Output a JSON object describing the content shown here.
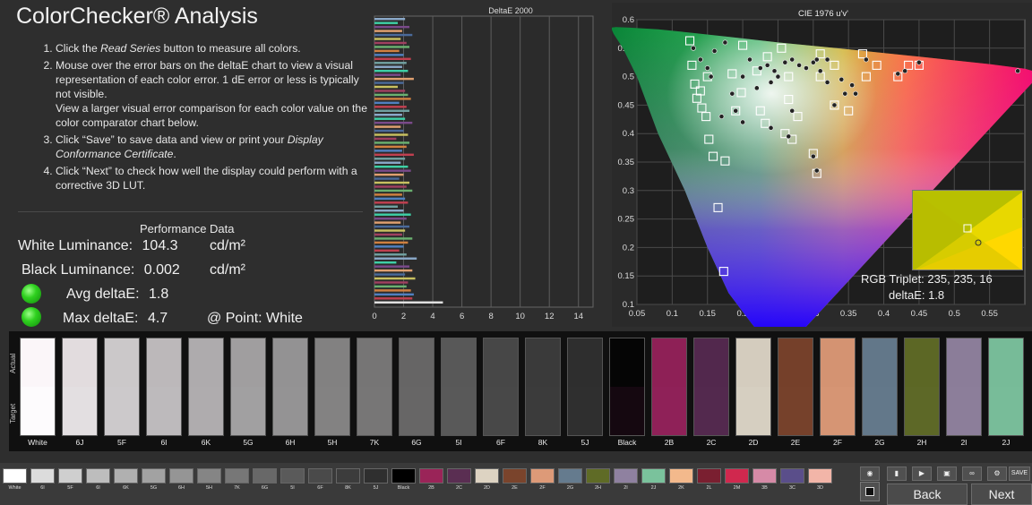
{
  "title": "ColorChecker® Analysis",
  "steps": [
    {
      "pre": "Click the ",
      "em": "Read Series",
      "post": " button to measure all colors."
    },
    {
      "pre": "Mouse over the error bars on the deltaE chart to view a visual representation of each color error. 1 dE error or less is typically not visible.",
      "em": "",
      "post": ""
    },
    {
      "pre": "Click “Save” to save data and view or print your ",
      "em": "Display Conformance Certificate",
      "post": "."
    },
    {
      "pre": "Click “Next” to check how well the display could perform with a corrective 3D LUT.",
      "em": "",
      "post": ""
    }
  ],
  "step2_extra": "View a larger visual error comparison for each color value on the color comparator chart below.",
  "performance": {
    "heading": "Performance Data",
    "white_label": "White Luminance:",
    "white_value": "104.3",
    "white_unit": "cd/m²",
    "black_label": "Black Luminance:",
    "black_value": "0.002",
    "black_unit": "cd/m²",
    "avg_label": "Avg deltaE:",
    "avg_value": "1.8",
    "max_label": "Max deltaE:",
    "max_value": "4.7",
    "point_label": "@ Point: White",
    "status_color": "#2fd11f"
  },
  "chart_data": [
    {
      "type": "bar",
      "title": "DeltaE 2000",
      "orientation": "horizontal",
      "xlim": [
        0,
        15
      ],
      "xticks": [
        0,
        2,
        4,
        6,
        8,
        10,
        12,
        14
      ],
      "grid": true,
      "values": [
        2.1,
        1.6,
        2.4,
        1.9,
        2.6,
        1.8,
        2.2,
        2.4,
        1.7,
        2.0,
        2.5,
        2.2,
        1.9,
        2.3,
        1.8,
        2.7,
        2.0,
        1.6,
        2.1,
        2.3,
        2.5,
        1.7,
        2.2,
        2.4,
        1.9,
        2.1,
        2.6,
        1.8,
        2.0,
        2.3,
        1.5,
        2.4,
        2.2,
        1.9,
        2.7,
        2.1,
        1.8,
        2.3,
        2.5,
        2.0,
        1.7,
        2.4,
        2.2,
        2.6,
        1.9,
        2.1,
        2.3,
        1.6,
        2.0,
        2.5,
        2.2,
        1.8,
        2.4,
        2.1,
        1.9,
        2.6,
        2.3,
        2.0,
        1.7,
        2.2,
        2.9,
        1.5,
        2.4,
        2.6,
        2.1,
        2.8,
        2.3,
        2.2,
        2.5,
        2.7,
        2.6,
        4.7
      ],
      "bar_colors": [
        "#8aa8c8",
        "#3ecfa6",
        "#7a4a8a",
        "#e0a070",
        "#4a6a9a",
        "#c8c060",
        "#a04060",
        "#6ab070",
        "#d08040",
        "#5080c0",
        "#c04050",
        "#70a0a0"
      ]
    },
    {
      "type": "scatter",
      "title": "CIE 1976 u'v'",
      "xlim": [
        0.05,
        0.6
      ],
      "ylim": [
        0.1,
        0.6
      ],
      "xticks": [
        0.05,
        0.1,
        0.15,
        0.2,
        0.25,
        0.3,
        0.35,
        0.4,
        0.45,
        0.5,
        0.55
      ],
      "yticks": [
        0.1,
        0.15,
        0.2,
        0.25,
        0.3,
        0.35,
        0.4,
        0.45,
        0.5,
        0.55,
        0.6
      ],
      "grid": true,
      "target_squares": [
        [
          0.125,
          0.563
        ],
        [
          0.128,
          0.52
        ],
        [
          0.132,
          0.487
        ],
        [
          0.135,
          0.462
        ],
        [
          0.142,
          0.445
        ],
        [
          0.148,
          0.43
        ],
        [
          0.152,
          0.39
        ],
        [
          0.158,
          0.36
        ],
        [
          0.175,
          0.352
        ],
        [
          0.165,
          0.27
        ],
        [
          0.173,
          0.158
        ],
        [
          0.19,
          0.44
        ],
        [
          0.198,
          0.472
        ],
        [
          0.2,
          0.555
        ],
        [
          0.22,
          0.51
        ],
        [
          0.225,
          0.44
        ],
        [
          0.232,
          0.418
        ],
        [
          0.26,
          0.4
        ],
        [
          0.27,
          0.39
        ],
        [
          0.278,
          0.43
        ],
        [
          0.265,
          0.46
        ],
        [
          0.3,
          0.365
        ],
        [
          0.305,
          0.33
        ],
        [
          0.33,
          0.45
        ],
        [
          0.35,
          0.44
        ],
        [
          0.375,
          0.5
        ],
        [
          0.39,
          0.52
        ],
        [
          0.42,
          0.5
        ],
        [
          0.435,
          0.52
        ],
        [
          0.45,
          0.52
        ],
        [
          0.37,
          0.54
        ],
        [
          0.31,
          0.54
        ],
        [
          0.255,
          0.55
        ],
        [
          0.235,
          0.535
        ],
        [
          0.185,
          0.505
        ],
        [
          0.15,
          0.5
        ],
        [
          0.14,
          0.475
        ],
        [
          0.265,
          0.5
        ],
        [
          0.31,
          0.5
        ],
        [
          0.33,
          0.52
        ]
      ],
      "measured_dots": [
        [
          0.13,
          0.55
        ],
        [
          0.14,
          0.53
        ],
        [
          0.15,
          0.515
        ],
        [
          0.155,
          0.5
        ],
        [
          0.16,
          0.545
        ],
        [
          0.175,
          0.56
        ],
        [
          0.2,
          0.5
        ],
        [
          0.21,
          0.53
        ],
        [
          0.225,
          0.515
        ],
        [
          0.235,
          0.52
        ],
        [
          0.245,
          0.51
        ],
        [
          0.25,
          0.5
        ],
        [
          0.26,
          0.525
        ],
        [
          0.27,
          0.53
        ],
        [
          0.28,
          0.52
        ],
        [
          0.29,
          0.515
        ],
        [
          0.3,
          0.525
        ],
        [
          0.31,
          0.51
        ],
        [
          0.32,
          0.49
        ],
        [
          0.34,
          0.495
        ],
        [
          0.355,
          0.485
        ],
        [
          0.36,
          0.47
        ],
        [
          0.345,
          0.47
        ],
        [
          0.24,
          0.49
        ],
        [
          0.22,
          0.48
        ],
        [
          0.185,
          0.47
        ],
        [
          0.19,
          0.44
        ],
        [
          0.17,
          0.43
        ],
        [
          0.2,
          0.42
        ],
        [
          0.24,
          0.41
        ],
        [
          0.265,
          0.395
        ],
        [
          0.3,
          0.36
        ],
        [
          0.305,
          0.335
        ],
        [
          0.27,
          0.44
        ],
        [
          0.33,
          0.45
        ],
        [
          0.42,
          0.505
        ],
        [
          0.43,
          0.51
        ],
        [
          0.45,
          0.525
        ],
        [
          0.59,
          0.51
        ],
        [
          0.305,
          0.53
        ],
        [
          0.375,
          0.53
        ],
        [
          0.32,
          0.53
        ]
      ]
    }
  ],
  "inset": {
    "rgb_label": "RGB Triplet: 235, 235, 16",
    "delta_label": "deltaE: 1.8",
    "color": "#f0f010"
  },
  "comparator": {
    "actual_label": "Actual",
    "target_label": "Target",
    "swatches": [
      {
        "name": "White",
        "actual": "#fbf6f9",
        "target": "#fdfbfd"
      },
      {
        "name": "6J",
        "actual": "#e2dcde",
        "target": "#e3dfe1"
      },
      {
        "name": "5F",
        "actual": "#cbc8c9",
        "target": "#ccc9cb"
      },
      {
        "name": "6I",
        "actual": "#bcb8ba",
        "target": "#bdbabc"
      },
      {
        "name": "6K",
        "actual": "#aeabad",
        "target": "#afacae"
      },
      {
        "name": "5G",
        "actual": "#a09e9f",
        "target": "#a1a0a1"
      },
      {
        "name": "6H",
        "actual": "#939293",
        "target": "#949394"
      },
      {
        "name": "5H",
        "actual": "#828181",
        "target": "#838282"
      },
      {
        "name": "7K",
        "actual": "#767575",
        "target": "#777676"
      },
      {
        "name": "6G",
        "actual": "#666565",
        "target": "#676666"
      },
      {
        "name": "5I",
        "actual": "#585858",
        "target": "#595959"
      },
      {
        "name": "6F",
        "actual": "#474747",
        "target": "#484848"
      },
      {
        "name": "8K",
        "actual": "#3a3a3a",
        "target": "#3b3b3b"
      },
      {
        "name": "5J",
        "actual": "#2e2e2e",
        "target": "#2f2f2f"
      },
      {
        "name": "Black",
        "actual": "#050505",
        "target": "#150810"
      },
      {
        "name": "2B",
        "actual": "#8e2056",
        "target": "#8f2158"
      },
      {
        "name": "2C",
        "actual": "#52284d",
        "target": "#53294e"
      },
      {
        "name": "2D",
        "actual": "#d4ccbe",
        "target": "#d6cfc1"
      },
      {
        "name": "2E",
        "actual": "#75402a",
        "target": "#76412b"
      },
      {
        "name": "2F",
        "actual": "#d49372",
        "target": "#d69574"
      },
      {
        "name": "2G",
        "actual": "#627789",
        "target": "#63788a"
      },
      {
        "name": "2H",
        "actual": "#5c6725",
        "target": "#5d6827"
      },
      {
        "name": "2I",
        "actual": "#8b7d99",
        "target": "#8c7e9a"
      },
      {
        "name": "2J",
        "actual": "#77bb98",
        "target": "#78bc99"
      }
    ]
  },
  "bottom_chips": [
    {
      "name": "White",
      "color": "#ffffff"
    },
    {
      "name": "6I",
      "color": "#dcdcdc"
    },
    {
      "name": "5F",
      "color": "#cfcfcf"
    },
    {
      "name": "6I",
      "color": "#bdbdbd"
    },
    {
      "name": "6K",
      "color": "#b0b0b0"
    },
    {
      "name": "5G",
      "color": "#a2a2a2"
    },
    {
      "name": "6H",
      "color": "#959595"
    },
    {
      "name": "5H",
      "color": "#858585"
    },
    {
      "name": "7K",
      "color": "#777777"
    },
    {
      "name": "6G",
      "color": "#686868"
    },
    {
      "name": "5I",
      "color": "#5a5a5a"
    },
    {
      "name": "6F",
      "color": "#4a4a4a"
    },
    {
      "name": "8K",
      "color": "#3c3c3c"
    },
    {
      "name": "5J",
      "color": "#2f2f2f"
    },
    {
      "name": "Black",
      "color": "#000000"
    },
    {
      "name": "2B",
      "color": "#9a2458"
    },
    {
      "name": "2C",
      "color": "#5a2e52"
    },
    {
      "name": "2D",
      "color": "#ddd3c2"
    },
    {
      "name": "2E",
      "color": "#7a442c"
    },
    {
      "name": "2F",
      "color": "#dd9a78"
    },
    {
      "name": "2G",
      "color": "#657b8e"
    },
    {
      "name": "2H",
      "color": "#5f6b26"
    },
    {
      "name": "2I",
      "color": "#8f81a0"
    },
    {
      "name": "2J",
      "color": "#7ac29c"
    },
    {
      "name": "2K",
      "color": "#f3b98c"
    },
    {
      "name": "2L",
      "color": "#7a1f30"
    },
    {
      "name": "2M",
      "color": "#d0284e"
    },
    {
      "name": "3B",
      "color": "#d68aa7"
    },
    {
      "name": "3C",
      "color": "#5a4e8a"
    },
    {
      "name": "3D",
      "color": "#f2b5a8"
    },
    {
      "name": "3E",
      "color": "#e87a1a"
    }
  ],
  "toolbar": {
    "save_label": "SAVE",
    "back_label": "Back",
    "next_label": "Next",
    "stop_icon": "stop-icon"
  }
}
